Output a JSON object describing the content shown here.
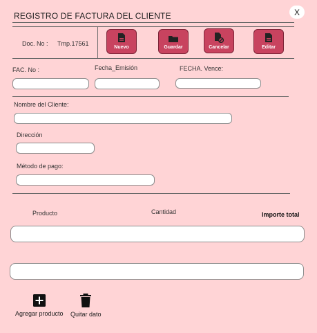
{
  "header": {
    "title": "REGISTRO DE FACTURA DEL CLIENTE",
    "close_label": "X"
  },
  "toolbar": {
    "doc_label": "Doc. No :",
    "doc_value": "Tmp.17561",
    "buttons": [
      {
        "label": "Nuevo",
        "icon": "new-document-icon"
      },
      {
        "label": "Guardar",
        "icon": "folder-icon"
      },
      {
        "label": "Cancelar",
        "icon": "cancel-document-icon"
      },
      {
        "label": "Editar",
        "icon": "edit-document-icon"
      }
    ]
  },
  "invoice": {
    "fac_label": "FAC. No :",
    "fecha_emision_label": "Fecha_Emisión",
    "fecha_vence_label": "FECHA. Vence:"
  },
  "client": {
    "nombre_label": "Nombre del Cliente:",
    "direccion_label": "Dirección",
    "metodo_label": "Método de pago:"
  },
  "items": {
    "columns": [
      "Producto",
      "Cantidad",
      "Importe total"
    ]
  },
  "actions": {
    "add_label": "Agregar producto",
    "remove_label": "Quitar dato"
  },
  "colors": {
    "background": "#ffd4d6",
    "button": "#c8435f"
  }
}
